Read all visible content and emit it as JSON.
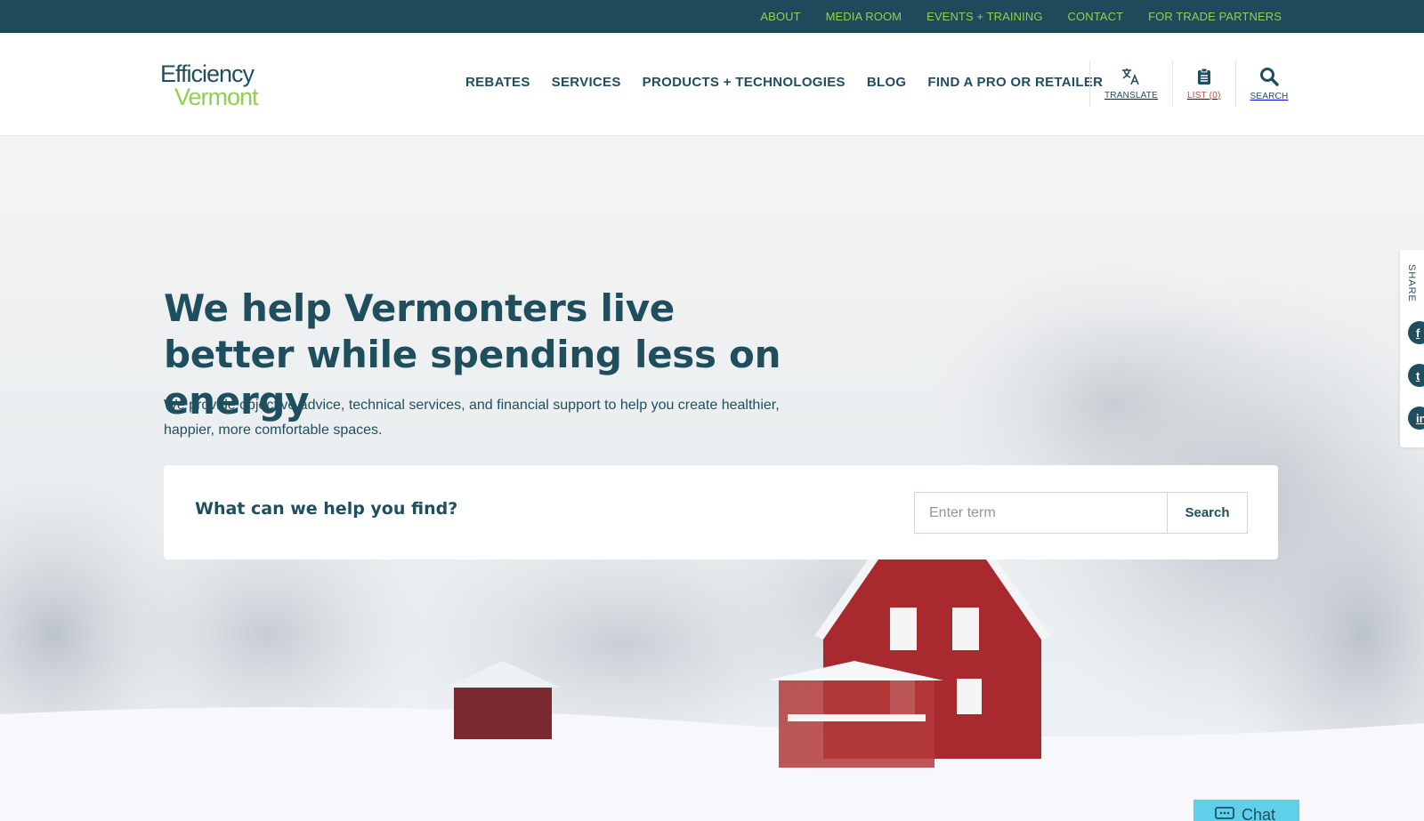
{
  "utility_nav": [
    "ABOUT",
    "MEDIA ROOM",
    "EVENTS + TRAINING",
    "CONTACT",
    "FOR TRADE PARTNERS"
  ],
  "logo": {
    "line1": "Efficiency",
    "line2": "Vermont"
  },
  "main_nav": [
    "REBATES",
    "SERVICES",
    "PRODUCTS + TECHNOLOGIES",
    "BLOG",
    "FIND A PRO OR RETAILER"
  ],
  "tools": {
    "translate": "TRANSLATE",
    "list": "LIST (0)",
    "search": "SEARCH"
  },
  "hero": {
    "title": "We help Vermonters live better while spending less on energy",
    "subtitle": "We provide objective advice, technical services, and financial support to help you create healthier, happier, more comfortable spaces.",
    "search_question": "What can we help you find?",
    "search_placeholder": "Enter term",
    "search_button": "Search"
  },
  "share": {
    "label": "SHARE",
    "networks": [
      "facebook-icon",
      "twitter-icon",
      "linkedin-icon"
    ]
  },
  "chat": {
    "label": "Chat"
  },
  "colors": {
    "brand_dark": "#1f4f5e",
    "brand_green": "#8fd14f",
    "list_red": "#c7482e",
    "chat_blue": "#5fd0ea"
  }
}
